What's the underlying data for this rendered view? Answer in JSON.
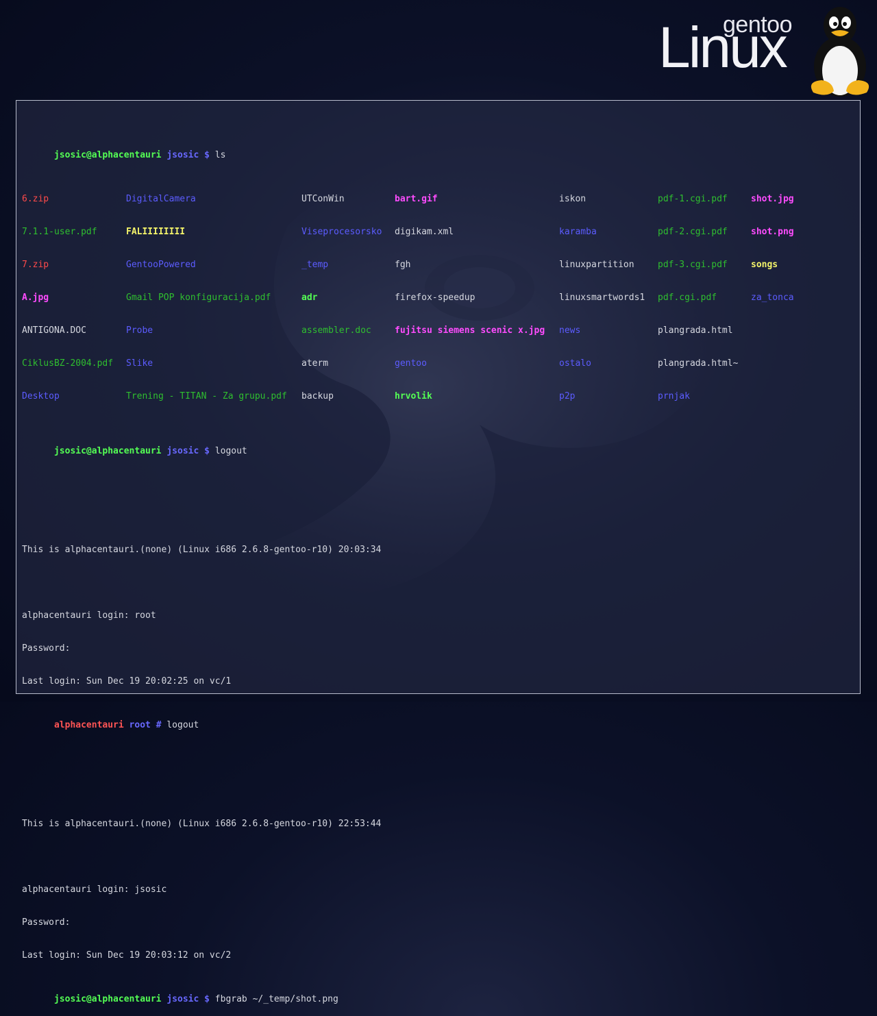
{
  "logo": {
    "small": "gentoo",
    "large": "Linux"
  },
  "prompt_user": {
    "host": "jsosic@alphacentauri",
    "dir": "jsosic",
    "sym": "$"
  },
  "prompt_root": {
    "host": "alphacentauri",
    "dir": "root",
    "sym": "#"
  },
  "session": {
    "cmd_ls": "ls",
    "ls_columns": [
      [
        "6.zip",
        "7.1.1-user.pdf",
        "7.zip",
        "A.jpg",
        "ANTIGONA.DOC",
        "CiklusBZ-2004.pdf",
        "Desktop"
      ],
      [
        "DigitalCamera",
        "FALIIIIIIII",
        "GentooPowered",
        "Gmail POP konfiguracija.pdf",
        "Probe",
        "Slike",
        "Trening - TITAN - Za grupu.pdf"
      ],
      [
        "UTConWin",
        "Viseprocesorsko",
        "_temp",
        "adr",
        "assembler.doc",
        "aterm",
        "backup"
      ],
      [
        "bart.gif",
        "digikam.xml",
        "fgh",
        "firefox-speedup",
        "fujitsu siemens scenic x.jpg",
        "gentoo",
        "hrvolik"
      ],
      [
        "iskon",
        "karamba",
        "linuxpartition",
        "linuxsmartwords1",
        "news",
        "ostalo",
        "p2p"
      ],
      [
        "pdf-1.cgi.pdf",
        "pdf-2.cgi.pdf",
        "pdf-3.cgi.pdf",
        "pdf.cgi.pdf",
        "plangrada.html",
        "plangrada.html~",
        "prnjak"
      ],
      [
        "shot.jpg",
        "shot.png",
        "songs",
        "za_tonca"
      ]
    ],
    "cmd_logout": "logout",
    "banner1": "This is alphacentauri.(none) (Linux i686 2.6.8-gentoo-r10) 20:03:34",
    "login1": "alphacentauri login: root",
    "password_prompt": "Password:",
    "lastlogin1": "Last login: Sun Dec 19 20:02:25 on vc/1",
    "banner2": "This is alphacentauri.(none) (Linux i686 2.6.8-gentoo-r10) 22:53:44",
    "login2": "alphacentauri login: jsosic",
    "lastlogin2": "Last login: Sun Dec 19 20:03:12 on vc/2",
    "cmd_fbgrab": "fbgrab ~/_temp/shot.png"
  }
}
